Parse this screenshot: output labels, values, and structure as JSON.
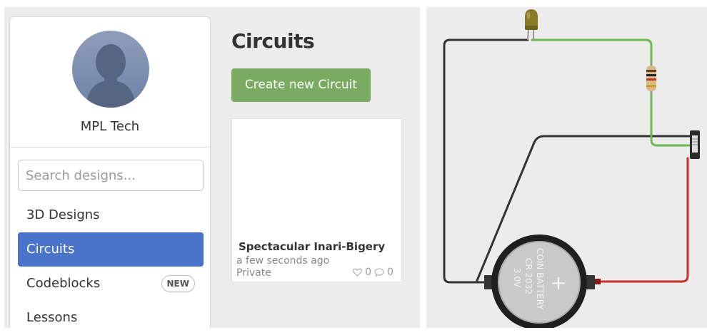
{
  "sidebar": {
    "user_name": "MPL Tech",
    "search": {
      "placeholder": "Search designs...",
      "value": ""
    },
    "nav_items": [
      {
        "label": "3D Designs",
        "active": false
      },
      {
        "label": "Circuits",
        "active": true
      },
      {
        "label": "Codeblocks",
        "active": false,
        "badge": "NEW"
      },
      {
        "label": "Lessons",
        "active": false
      }
    ]
  },
  "main": {
    "title": "Circuits",
    "create_button": "Create new Circuit",
    "designs": [
      {
        "title": "Spectacular Inari-Bigery",
        "time": "a few seconds ago",
        "privacy": "Private",
        "likes": "0",
        "comments": "0"
      }
    ]
  },
  "circuit": {
    "battery_lines": [
      "COIN BATTERY",
      "CR 2032",
      "3.0V"
    ],
    "battery_plus": "+",
    "components": [
      "led",
      "resistor",
      "slide-switch",
      "coin-battery"
    ],
    "colors": {
      "wire_black": "#333333",
      "wire_green": "#6cb94f",
      "wire_red": "#c8302b",
      "led": "#8a7a28",
      "accent_blue": "#4a74c9",
      "button_green": "#7bab62"
    }
  }
}
